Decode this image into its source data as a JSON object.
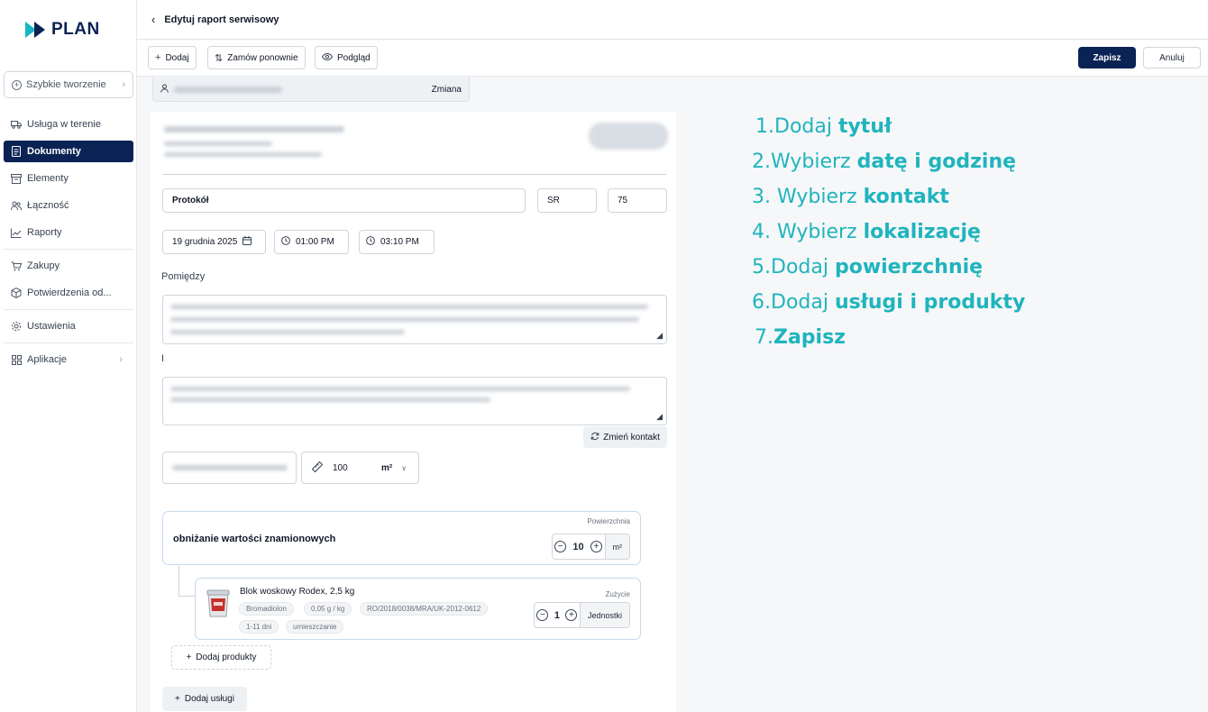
{
  "brand": {
    "name": "PLAN",
    "accent": "#19b6c4",
    "navy": "#0b2354"
  },
  "sidebar": {
    "quick_create": "Szybkie tworzenie",
    "items": [
      {
        "label": "Usługa w terenie",
        "icon": "truck-icon"
      },
      {
        "label": "Dokumenty",
        "icon": "document-icon",
        "active": true
      },
      {
        "label": "Elementy",
        "icon": "box-icon"
      },
      {
        "label": "Łączność",
        "icon": "people-icon"
      },
      {
        "label": "Raporty",
        "icon": "chart-icon"
      },
      {
        "label": "Zakupy",
        "icon": "cart-icon"
      },
      {
        "label": "Potwierdzenia od...",
        "icon": "package-icon"
      },
      {
        "label": "Ustawienia",
        "icon": "gear-icon"
      },
      {
        "label": "Aplikacje",
        "icon": "grid-icon"
      }
    ]
  },
  "header": {
    "title": "Edytuj raport serwisowy"
  },
  "toolbar": {
    "add": "Dodaj",
    "reorder": "Zamów ponownie",
    "preview": "Podgląd",
    "save": "Zapisz",
    "cancel": "Anuluj"
  },
  "contact_strip": {
    "change": "Zmiana"
  },
  "form": {
    "title_value": "Protokół",
    "prefix_value": "SR",
    "number_value": "75",
    "date_value": "19 grudnia 2025",
    "time_start": "01:00 PM",
    "time_end": "03:10 PM",
    "between_label": "Pomiędzy",
    "and_label": "I",
    "change_contact": "Zmień kontakt",
    "area_value": "100",
    "area_unit": "m²"
  },
  "service": {
    "name": "obniżanie wartości znamionowych",
    "caption": "Powierzchnia",
    "qty": "10",
    "unit": "m²"
  },
  "product": {
    "name": "Blok woskowy Rodex, 2,5 kg",
    "caption": "Zużycie",
    "qty": "1",
    "unit": "Jednostki",
    "tags": [
      "Bromadiolon",
      "0,05 g / kg",
      "RO/2018/0038/MRA/UK-2012-0612",
      "1-11 dni",
      "umieszczanie"
    ]
  },
  "add_products": "Dodaj produkty",
  "add_services": "Dodaj usługi",
  "instructions": [
    {
      "num": "1.",
      "text": "Dodaj ",
      "bold": "tytuł"
    },
    {
      "num": "2.",
      "text": "Wybierz ",
      "bold": "datę i godzinę"
    },
    {
      "num": "3.",
      "text": " Wybierz ",
      "bold": "kontakt"
    },
    {
      "num": "4.",
      "text": " Wybierz ",
      "bold": "lokalizację"
    },
    {
      "num": "5.",
      "text": "Dodaj ",
      "bold": "powierzchnię"
    },
    {
      "num": "6.",
      "text": "Dodaj ",
      "bold": "usługi i produkty"
    },
    {
      "num": "7.",
      "text": "",
      "bold": "Zapisz"
    }
  ]
}
